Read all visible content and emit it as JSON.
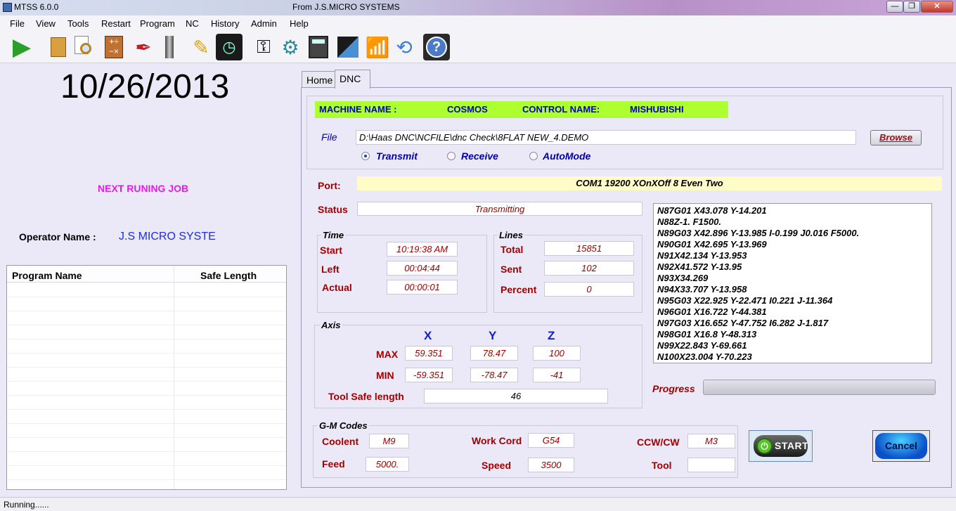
{
  "window": {
    "app_name": "MTSS 6.0.0",
    "caption": "From  J.S.MICRO SYSTEMS"
  },
  "menu": [
    "File",
    "View",
    "Tools",
    "Restart",
    "Program",
    "NC",
    "History",
    "Admin",
    "Help"
  ],
  "left": {
    "date": "10/26/2013",
    "next_job": "NEXT RUNING JOB",
    "operator_label": "Operator Name :",
    "operator_value": "J.S MICRO SYSTE",
    "table_headers": [
      "Program Name",
      "Safe Length"
    ]
  },
  "tabs": [
    "Home",
    "DNC"
  ],
  "dnc": {
    "machine_label": "MACHINE NAME :",
    "machine_value": "COSMOS",
    "control_label": "CONTROL NAME:",
    "control_value": "MISHUBISHI",
    "file_label": "File",
    "file_path": "D:\\Haas DNC\\NCFILE\\dnc Check\\8FLAT NEW_4.DEMO",
    "browse": "Browse",
    "modes": [
      "Transmit",
      "Receive",
      "AutoMode"
    ],
    "mode_selected": "Transmit",
    "port_label": "Port:",
    "port_value": "COM1   19200   XOnXOff   8   Even   Two",
    "status_label": "Status",
    "status_value": "Transmitting",
    "time": {
      "title": "Time",
      "start_label": "Start",
      "start_value": "10:19:38 AM",
      "left_label": "Left",
      "left_value": "00:04:44",
      "actual_label": "Actual",
      "actual_value": "00:00:01"
    },
    "lines": {
      "title": "Lines",
      "total_label": "Total",
      "total_value": "15851",
      "sent_label": "Sent",
      "sent_value": "102",
      "percent_label": "Percent",
      "percent_value": "0"
    },
    "axis": {
      "title": "Axis",
      "headers": [
        "X",
        "Y",
        "Z"
      ],
      "max_label": "MAX",
      "max": [
        "59.351",
        "78.47",
        "100"
      ],
      "min_label": "MIN",
      "min": [
        "-59.351",
        "-78.47",
        "-41"
      ],
      "tool_safe_label": "Tool Safe length",
      "tool_safe_value": "46"
    },
    "gcode_lines": [
      "N87G01 X43.078 Y-14.201",
      "N88Z-1. F1500.",
      "N89G03 X42.896 Y-13.985 I-0.199 J0.016 F5000.",
      "N90G01 X42.695 Y-13.969",
      "N91X42.134 Y-13.953",
      "N92X41.572 Y-13.95",
      "N93X34.269",
      "N94X33.707 Y-13.958",
      "N95G03 X22.925 Y-22.471 I0.221 J-11.364",
      "N96G01 X16.722 Y-44.381",
      "N97G03 X16.652 Y-47.752 I6.282 J-1.817",
      "N98G01 X16.8 Y-48.313",
      "N99X22.843 Y-69.661",
      "N100X23.004 Y-70.223"
    ],
    "progress_label": "Progress",
    "progress": 0,
    "gm": {
      "title": "G-M Codes",
      "coolent_label": "Coolent",
      "coolent_value": "M9",
      "feed_label": "Feed",
      "feed_value": "5000.",
      "workcord_label": "Work Cord",
      "workcord_value": "G54",
      "speed_label": "Speed",
      "speed_value": "3500",
      "ccw_label": "CCW/CW",
      "ccw_value": "M3",
      "tool_label": "Tool",
      "tool_value": ""
    },
    "start_button": "START",
    "cancel_button": "Cancel"
  },
  "statusbar": "Running......",
  "colors": {
    "machine_bar": "#adff2f",
    "label_red": "#a00000",
    "label_blue": "#0000a8",
    "port_bg": "#fffcc8"
  }
}
